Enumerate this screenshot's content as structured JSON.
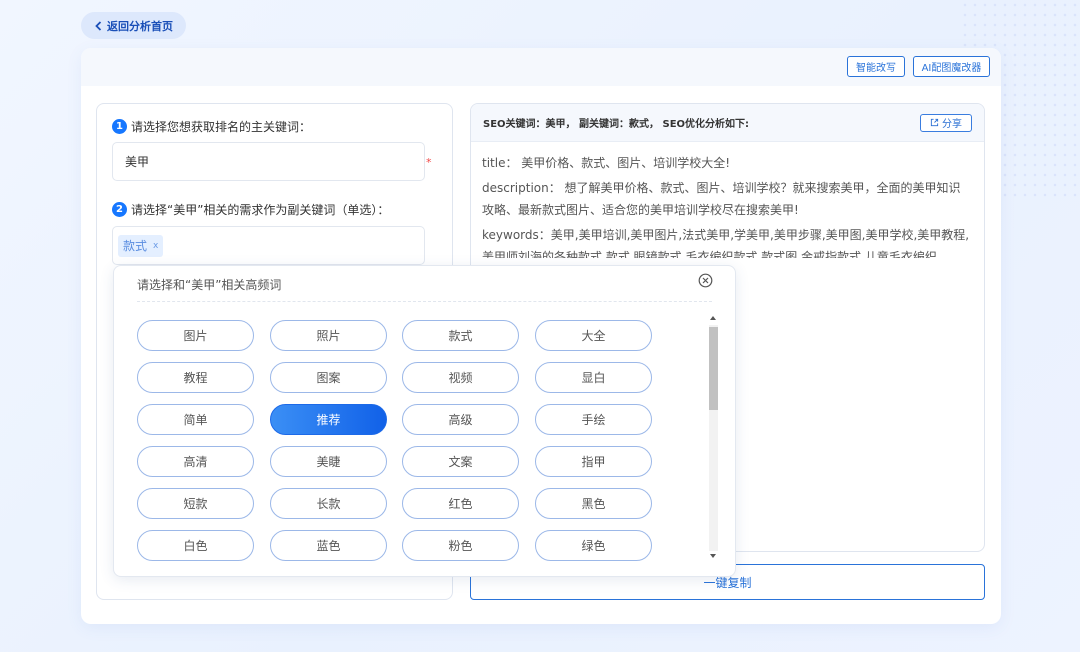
{
  "nav": {
    "back_label": "返回分析首页"
  },
  "toolbar": {
    "rewrite_label": "智能改写",
    "ai_image_label": "AI配图魔改器"
  },
  "step1": {
    "num": "1",
    "label": "请选择您想获取排名的主关键词：",
    "value": "美甲",
    "required_mark": "*"
  },
  "step2": {
    "num": "2",
    "label": "请选择“美甲”相关的需求作为副关键词（单选）：",
    "selected_tag": "款式",
    "tag_remove": "x"
  },
  "popup": {
    "title": "请选择和“美甲”相关高频词",
    "chips": [
      "图片",
      "照片",
      "款式",
      "大全",
      "教程",
      "图案",
      "视频",
      "显白",
      "简单",
      "推荐",
      "高级",
      "手绘",
      "高清",
      "美睫",
      "文案",
      "指甲",
      "短款",
      "长款",
      "红色",
      "黑色",
      "白色",
      "蓝色",
      "粉色",
      "绿色"
    ],
    "selected_chip": "推荐"
  },
  "result": {
    "header": "SEO关键词：美甲， 副关键词：款式， SEO优化分析如下:",
    "share_label": "分享",
    "title_line": "title：  美甲价格、款式、图片、培训学校大全!",
    "description_line": "description：  想了解美甲价格、款式、图片、培训学校？就来搜索美甲，全面的美甲知识攻略、最新款式图片、适合您的美甲培训学校尽在搜索美甲!",
    "keywords_line": "keywords：美甲,美甲培训,美甲图片,法式美甲,学美甲,美甲步骤,美甲图,美甲学校,美甲教程,美甲师刘海的各种款式,款式,眼镜款式,毛衣编织款式,款式图,金戒指款式,儿童毛衣编织"
  },
  "copy_label": "一键复制",
  "colors": {
    "accent": "#2a73d9",
    "selected_chip": "#1677ff",
    "required": "#f04848"
  }
}
